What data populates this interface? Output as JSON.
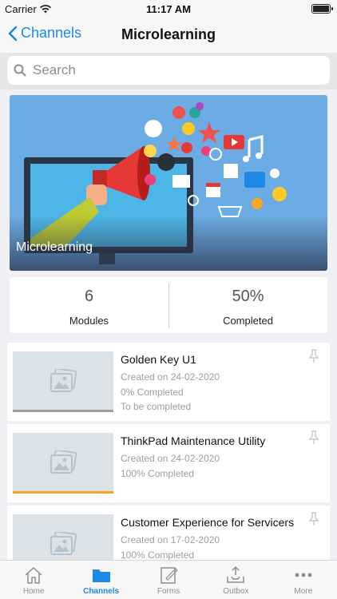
{
  "status_bar": {
    "carrier": "Carrier",
    "time": "11:17 AM"
  },
  "nav": {
    "back_label": "Channels",
    "title": "Microlearning"
  },
  "search": {
    "placeholder": "Search"
  },
  "banner": {
    "title": "Microlearning"
  },
  "stats": [
    {
      "value": "6",
      "label": "Modules"
    },
    {
      "value": "50%",
      "label": "Completed"
    }
  ],
  "modules": [
    {
      "title": "Golden Key U1",
      "created": "Created on 24-02-2020",
      "progress_text": "0% Completed",
      "status": "To be completed",
      "progress": 0.0,
      "bar_color": "#9e9e9e"
    },
    {
      "title": "ThinkPad Maintenance Utility",
      "created": "Created on 24-02-2020",
      "progress_text": "100% Completed",
      "status": "",
      "progress": 1.0,
      "bar_color": "#f5a623"
    },
    {
      "title": "Customer Experience for Servicers",
      "created": "Created on 17-02-2020",
      "progress_text": "100% Completed",
      "status": "",
      "progress": 1.0,
      "bar_color": "#f5a623"
    }
  ],
  "tabs": [
    {
      "label": "Home",
      "icon": "home-icon",
      "active": false
    },
    {
      "label": "Channels",
      "icon": "folder-icon",
      "active": true
    },
    {
      "label": "Forms",
      "icon": "form-icon",
      "active": false
    },
    {
      "label": "Outbox",
      "icon": "outbox-icon",
      "active": false
    },
    {
      "label": "More",
      "icon": "more-icon",
      "active": false
    }
  ],
  "colors": {
    "accent": "#1e88e5",
    "banner_bg": "#6cace4"
  }
}
